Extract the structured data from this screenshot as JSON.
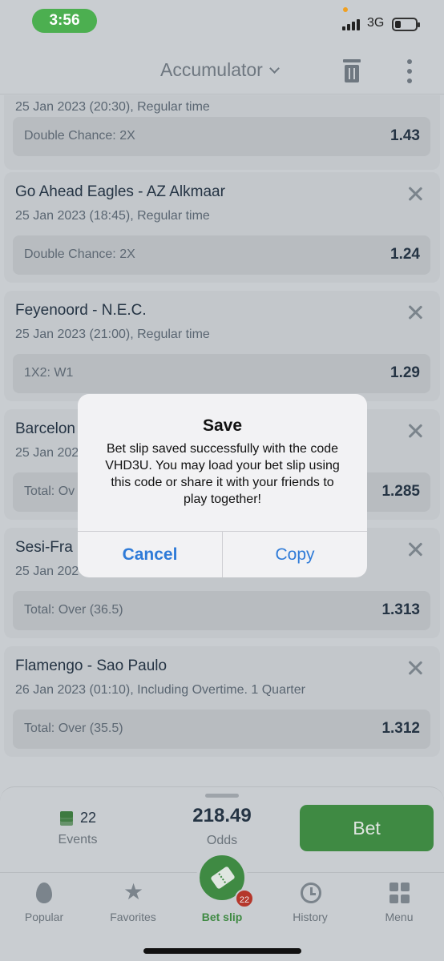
{
  "status": {
    "time": "3:56",
    "network": "3G"
  },
  "header": {
    "title": "Accumulator"
  },
  "cards": [
    {
      "match": "",
      "when": "25 Jan 2023 (20:30), Regular time",
      "market": "Double Chance: 2X",
      "odd": "1.43"
    },
    {
      "match": "Go Ahead Eagles - AZ Alkmaar",
      "when": "25 Jan 2023 (18:45), Regular time",
      "market": "Double Chance: 2X",
      "odd": "1.24"
    },
    {
      "match": "Feyenoord - N.E.C.",
      "when": "25 Jan 2023 (21:00), Regular time",
      "market": "1X2: W1",
      "odd": "1.29"
    },
    {
      "match": "Barcelon",
      "when": "25 Jan 202",
      "market": "Total: Ov",
      "odd": "1.285"
    },
    {
      "match": "Sesi-Fra",
      "when": "25 Jan 202",
      "market": "Total: Over (36.5)",
      "odd": "1.313"
    },
    {
      "match": "Flamengo - Sao Paulo",
      "when": "26 Jan 2023 (01:10), Including Overtime. 1 Quarter",
      "market": "Total: Over (35.5)",
      "odd": "1.312"
    }
  ],
  "summary": {
    "events_count": "22",
    "events_label": "Events",
    "odds_value": "218.49",
    "odds_label": "Odds",
    "bet_label": "Bet"
  },
  "tabs": [
    {
      "label": "Popular",
      "icon": "flame-icon"
    },
    {
      "label": "Favorites",
      "icon": "star-icon"
    },
    {
      "label": "Bet slip",
      "icon": "ticket-icon",
      "badge": "22"
    },
    {
      "label": "History",
      "icon": "clock-icon"
    },
    {
      "label": "Menu",
      "icon": "grid-icon"
    }
  ],
  "dialog": {
    "title": "Save",
    "message": "Bet slip saved successfully with the code VHD3U. You may load your bet slip using this code or share it with your friends to play together!",
    "cancel": "Cancel",
    "copy": "Copy"
  },
  "colors": {
    "accent": "#3f8a43",
    "dialog_action": "#2f7bd8",
    "badge": "#b5372b"
  }
}
